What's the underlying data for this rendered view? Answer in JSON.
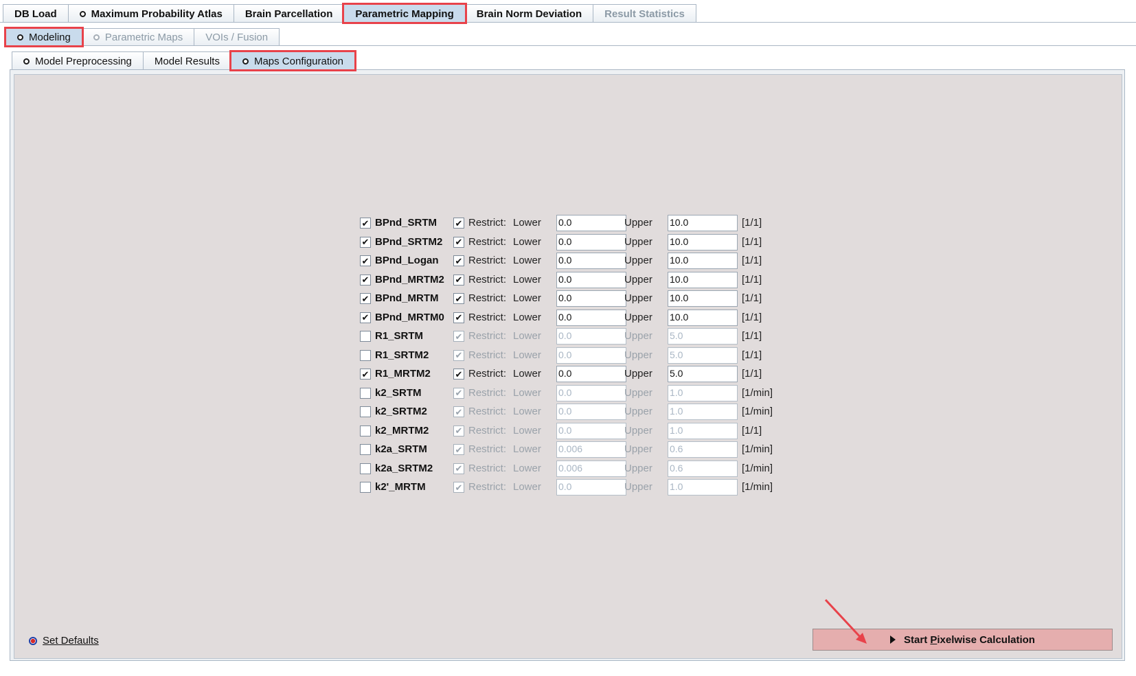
{
  "top_tabs": [
    {
      "label": "DB Load",
      "icon": "",
      "state": "normal"
    },
    {
      "label": "Maximum Probability Atlas",
      "icon": "radio-dot-icon",
      "state": "normal"
    },
    {
      "label": "Brain Parcellation",
      "icon": "",
      "state": "normal"
    },
    {
      "label": "Parametric Mapping",
      "icon": "",
      "state": "active"
    },
    {
      "label": "Brain Norm Deviation",
      "icon": "",
      "state": "normal"
    },
    {
      "label": "Result Statistics",
      "icon": "",
      "state": "disabled"
    }
  ],
  "sub_tabs": [
    {
      "label": "Modeling",
      "icon": "radio-dot-icon",
      "state": "active"
    },
    {
      "label": "Parametric Maps",
      "icon": "radio-dot-icon",
      "state": "disabled"
    },
    {
      "label": "VOIs / Fusion",
      "icon": "",
      "state": "disabled"
    }
  ],
  "inner_tabs": [
    {
      "label": "Model Preprocessing",
      "icon": "radio-dot-icon",
      "state": "normal"
    },
    {
      "label": "Model Results",
      "icon": "",
      "state": "normal"
    },
    {
      "label": "Maps Configuration",
      "icon": "radio-dot-icon",
      "state": "active"
    }
  ],
  "restrict_label": "Restrict:",
  "lower_label": "Lower",
  "upper_label": "Upper",
  "check_glyph": "✔",
  "rows": [
    {
      "name": "BPnd_SRTM",
      "enabled": true,
      "restrict": true,
      "lower": "0.0",
      "upper": "10.0",
      "unit": "[1/1]"
    },
    {
      "name": "BPnd_SRTM2",
      "enabled": true,
      "restrict": true,
      "lower": "0.0",
      "upper": "10.0",
      "unit": "[1/1]"
    },
    {
      "name": "BPnd_Logan",
      "enabled": true,
      "restrict": true,
      "lower": "0.0",
      "upper": "10.0",
      "unit": "[1/1]"
    },
    {
      "name": "BPnd_MRTM2",
      "enabled": true,
      "restrict": true,
      "lower": "0.0",
      "upper": "10.0",
      "unit": "[1/1]"
    },
    {
      "name": "BPnd_MRTM",
      "enabled": true,
      "restrict": true,
      "lower": "0.0",
      "upper": "10.0",
      "unit": "[1/1]"
    },
    {
      "name": "BPnd_MRTM0",
      "enabled": true,
      "restrict": true,
      "lower": "0.0",
      "upper": "10.0",
      "unit": "[1/1]"
    },
    {
      "name": "R1_SRTM",
      "enabled": false,
      "restrict": true,
      "lower": "0.0",
      "upper": "5.0",
      "unit": "[1/1]"
    },
    {
      "name": "R1_SRTM2",
      "enabled": false,
      "restrict": true,
      "lower": "0.0",
      "upper": "5.0",
      "unit": "[1/1]"
    },
    {
      "name": "R1_MRTM2",
      "enabled": true,
      "restrict": true,
      "lower": "0.0",
      "upper": "5.0",
      "unit": "[1/1]"
    },
    {
      "name": "k2_SRTM",
      "enabled": false,
      "restrict": true,
      "lower": "0.0",
      "upper": "1.0",
      "unit": "[1/min]"
    },
    {
      "name": "k2_SRTM2",
      "enabled": false,
      "restrict": true,
      "lower": "0.0",
      "upper": "1.0",
      "unit": "[1/min]"
    },
    {
      "name": "k2_MRTM2",
      "enabled": false,
      "restrict": true,
      "lower": "0.0",
      "upper": "1.0",
      "unit": "[1/1]"
    },
    {
      "name": "k2a_SRTM",
      "enabled": false,
      "restrict": true,
      "lower": "0.006",
      "upper": "0.6",
      "unit": "[1/min]"
    },
    {
      "name": "k2a_SRTM2",
      "enabled": false,
      "restrict": true,
      "lower": "0.006",
      "upper": "0.6",
      "unit": "[1/min]"
    },
    {
      "name": "k2'_MRTM",
      "enabled": false,
      "restrict": true,
      "lower": "0.0",
      "upper": "1.0",
      "unit": "[1/min]"
    }
  ],
  "set_defaults_label": "Set Defaults",
  "start_button": {
    "prefix": "Start ",
    "mnemonic": "P",
    "suffix": "ixelwise Calculation"
  },
  "colors": {
    "highlight": "#e8424a",
    "start_button_bg": "#e5aeae",
    "panel_bg": "#e1dcdc",
    "active_tab": "#c9dbec"
  }
}
